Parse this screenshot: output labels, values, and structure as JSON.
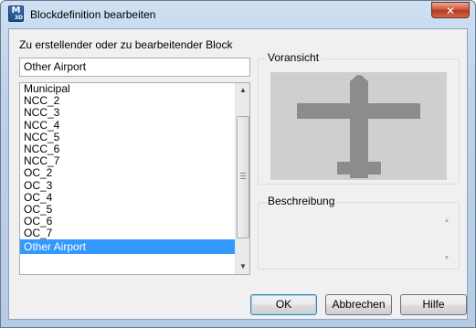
{
  "window": {
    "title": "Blockdefinition bearbeiten",
    "app_icon": {
      "name": "m3d-app-icon",
      "glyph": "M",
      "sub": "3D"
    },
    "close_glyph": "✕"
  },
  "block_label": "Zu erstellender oder zu bearbeitender Block",
  "block_name_value": "Other Airport",
  "block_list": {
    "items": [
      "Municipal",
      "NCC_2",
      "NCC_3",
      "NCC_4",
      "NCC_5",
      "NCC_6",
      "NCC_7",
      "OC_2",
      "OC_3",
      "OC_4",
      "OC_5",
      "OC_6",
      "OC_7",
      "Other Airport"
    ],
    "selected": "Other Airport",
    "selection_color": "#3399ff",
    "highlight_color": "#e0141c"
  },
  "preview": {
    "label": "Voransicht",
    "symbol": "airplane-icon",
    "background": "#cfcfcf",
    "symbol_color": "#8c8c8c"
  },
  "description": {
    "label": "Beschreibung",
    "text": ""
  },
  "buttons": {
    "ok": "OK",
    "cancel": "Abbrechen",
    "help": "Hilfe"
  }
}
